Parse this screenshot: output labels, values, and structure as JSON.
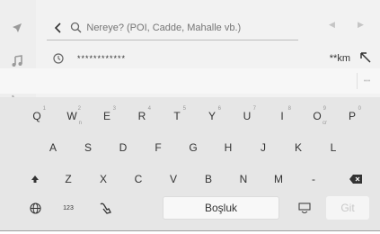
{
  "search": {
    "placeholder": "Nereye? (POI, Cadde, Mahalle vb.)",
    "back_icon": "chevron-left-icon",
    "icon": "search-icon"
  },
  "result": {
    "text": "************",
    "distance": "**km"
  },
  "keyboard": {
    "row1": [
      {
        "label": "Q",
        "sup": "1"
      },
      {
        "label": "W",
        "sup": "2",
        "sub": "n"
      },
      {
        "label": "E",
        "sup": "3"
      },
      {
        "label": "R",
        "sup": "4"
      },
      {
        "label": "T",
        "sup": "5"
      },
      {
        "label": "Y",
        "sup": "6"
      },
      {
        "label": "U",
        "sup": "7"
      },
      {
        "label": "I",
        "sup": "8"
      },
      {
        "label": "O",
        "sup": "9",
        "sub": "cr"
      },
      {
        "label": "P",
        "sup": "0"
      }
    ],
    "row2": [
      "A",
      "S",
      "D",
      "F",
      "G",
      "H",
      "J",
      "K",
      "L"
    ],
    "row3": [
      "Z",
      "X",
      "C",
      "V",
      "B",
      "N",
      "M",
      "-"
    ],
    "numbers_label": "123",
    "space_label": "Boşluk",
    "go_label": "Git"
  },
  "colors": {
    "background": "#f2f2f2",
    "keyboard": "#e6e6e6",
    "disabled_text": "#c8c8c8"
  }
}
